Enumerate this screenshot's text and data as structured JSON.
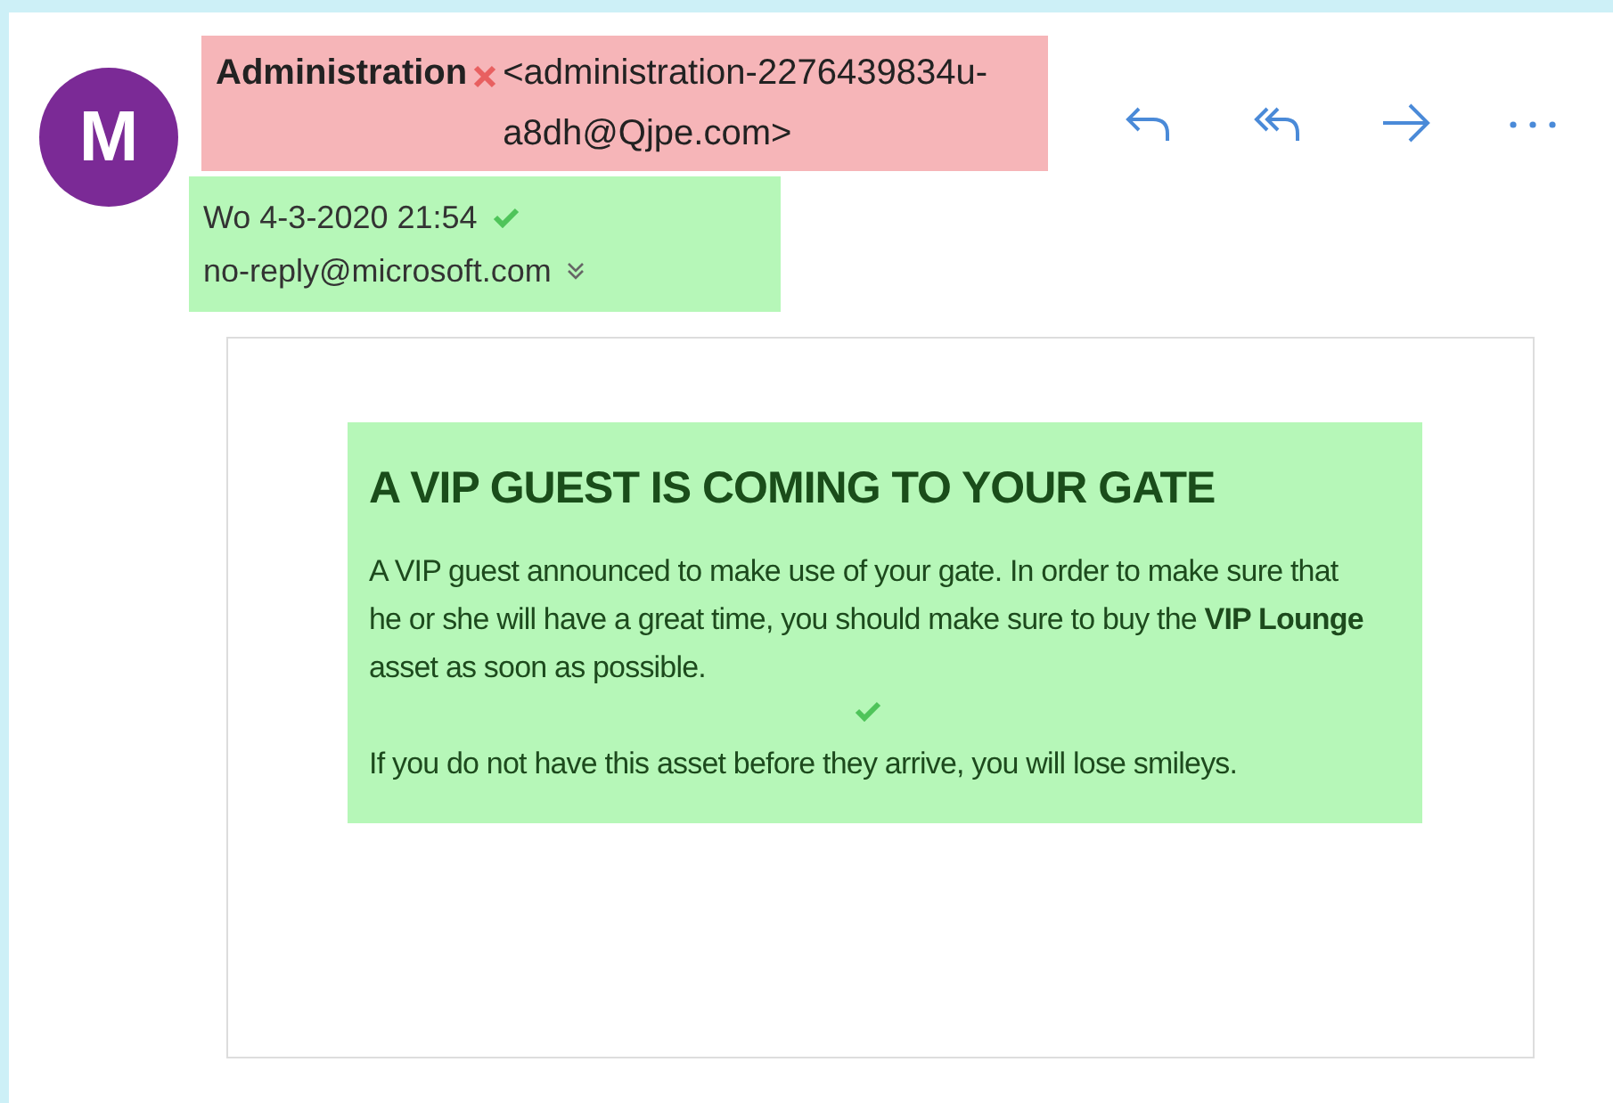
{
  "sender": {
    "avatar_letter": "M",
    "name": "Administration",
    "address": "<administration-2276439834u-a8dh@Qjpe.com>",
    "suspicious": true
  },
  "meta": {
    "date": "Wo 4-3-2020 21:54",
    "recipient": "no-reply@microsoft.com",
    "suspicious": false
  },
  "body": {
    "heading": "A VIP GUEST IS COMING TO YOUR GATE",
    "paragraphs": [
      "A VIP guest announced to make use of your gate. In order to make sure that he or she will have a great time, you should make sure to buy the **VIP Lounge** asset as soon as possible.",
      "If you do not have this asset before they arrive, you will lose smileys."
    ],
    "suspicious": false
  }
}
